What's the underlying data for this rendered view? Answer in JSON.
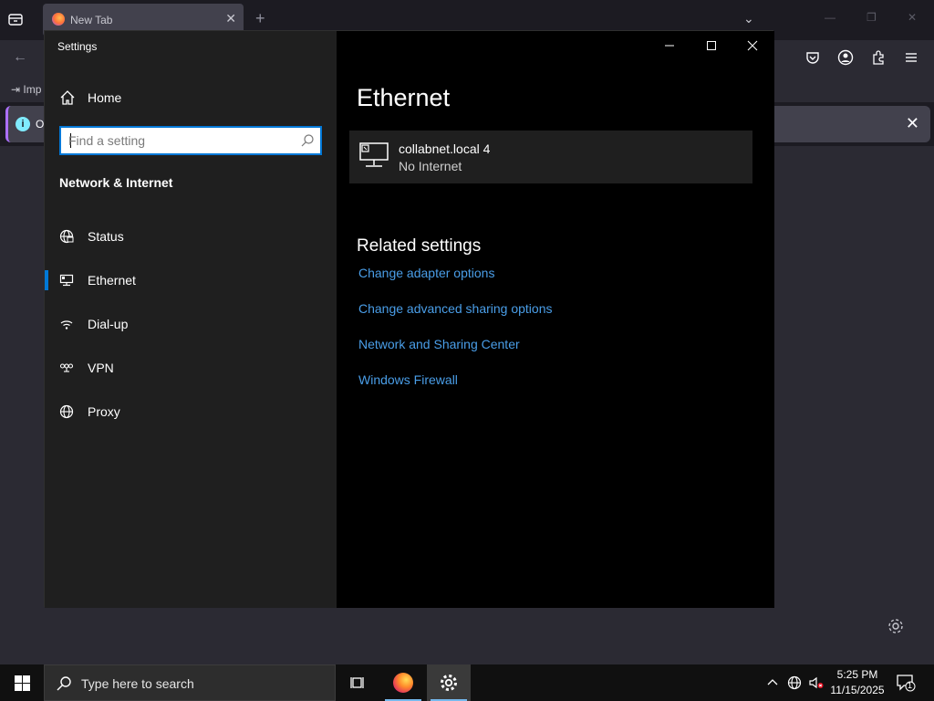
{
  "firefox": {
    "tab_title": "New Tab",
    "bookmark_import": "Imp",
    "notice_text": "O"
  },
  "settings": {
    "window_title": "Settings",
    "home_label": "Home",
    "search_placeholder": "Find a setting",
    "section_title": "Network & Internet",
    "nav_items": [
      {
        "label": "Status",
        "icon": "globe-status-icon",
        "selected": false
      },
      {
        "label": "Ethernet",
        "icon": "ethernet-icon",
        "selected": true
      },
      {
        "label": "Dial-up",
        "icon": "dialup-icon",
        "selected": false
      },
      {
        "label": "VPN",
        "icon": "vpn-icon",
        "selected": false
      },
      {
        "label": "Proxy",
        "icon": "globe-proxy-icon",
        "selected": false
      }
    ],
    "page_title": "Ethernet",
    "network": {
      "name": "collabnet.local 4",
      "status": "No Internet"
    },
    "related_title": "Related settings",
    "related_links": [
      "Change adapter options",
      "Change advanced sharing options",
      "Network and Sharing Center",
      "Windows Firewall"
    ],
    "accent_color": "#0078d7",
    "link_color": "#4a9ee8"
  },
  "taskbar": {
    "search_placeholder": "Type here to search",
    "time": "5:25 PM",
    "date": "11/15/2025",
    "notification_count": "1"
  }
}
